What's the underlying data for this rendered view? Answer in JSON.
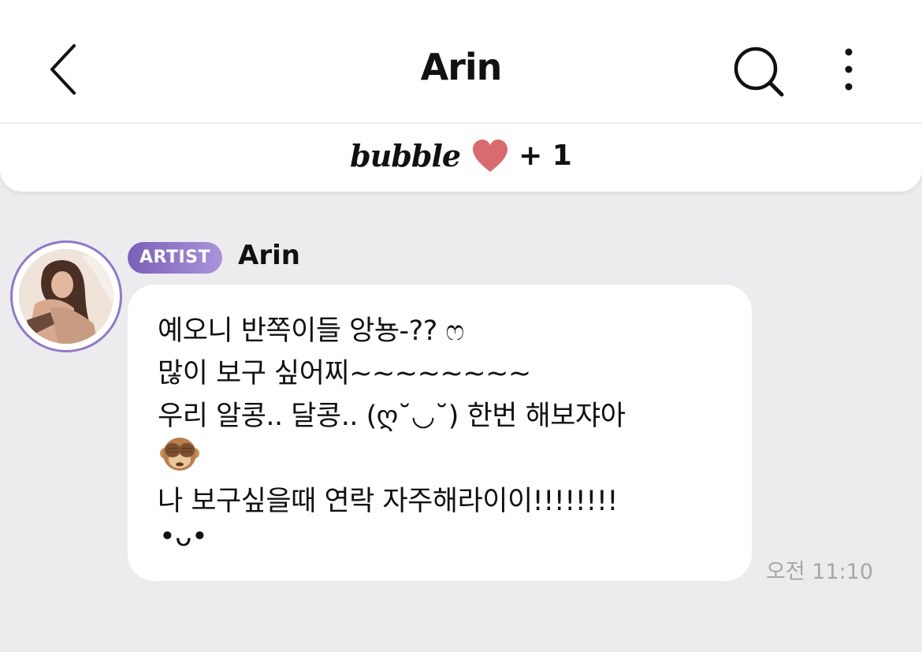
{
  "header": {
    "title": "Arin",
    "back_icon": "chevron-left-icon",
    "search_icon": "search-icon",
    "more_icon": "more-vertical-icon"
  },
  "bubble_bar": {
    "brand": "bubble",
    "heart_color": "#d96b70",
    "plus_count": "+ 1"
  },
  "message": {
    "badge": "ARTIST",
    "badge_color": "#8f79c6",
    "sender": "Arin",
    "lines": [
      "예오니 반쪽이들 앙뇽-?? ෆ",
      "많이 보구 싶어찌~~~~~~~~",
      "우리 알콩.. 달콩.. (ღ˘◡˘)  한번 해보쟈아",
      "나 보구싶을때 연락 자주해라이이!!!!!!!!",
      "•ᴗ•"
    ],
    "emoji": "see-no-evil-monkey-icon",
    "time": "오전 11:10"
  }
}
